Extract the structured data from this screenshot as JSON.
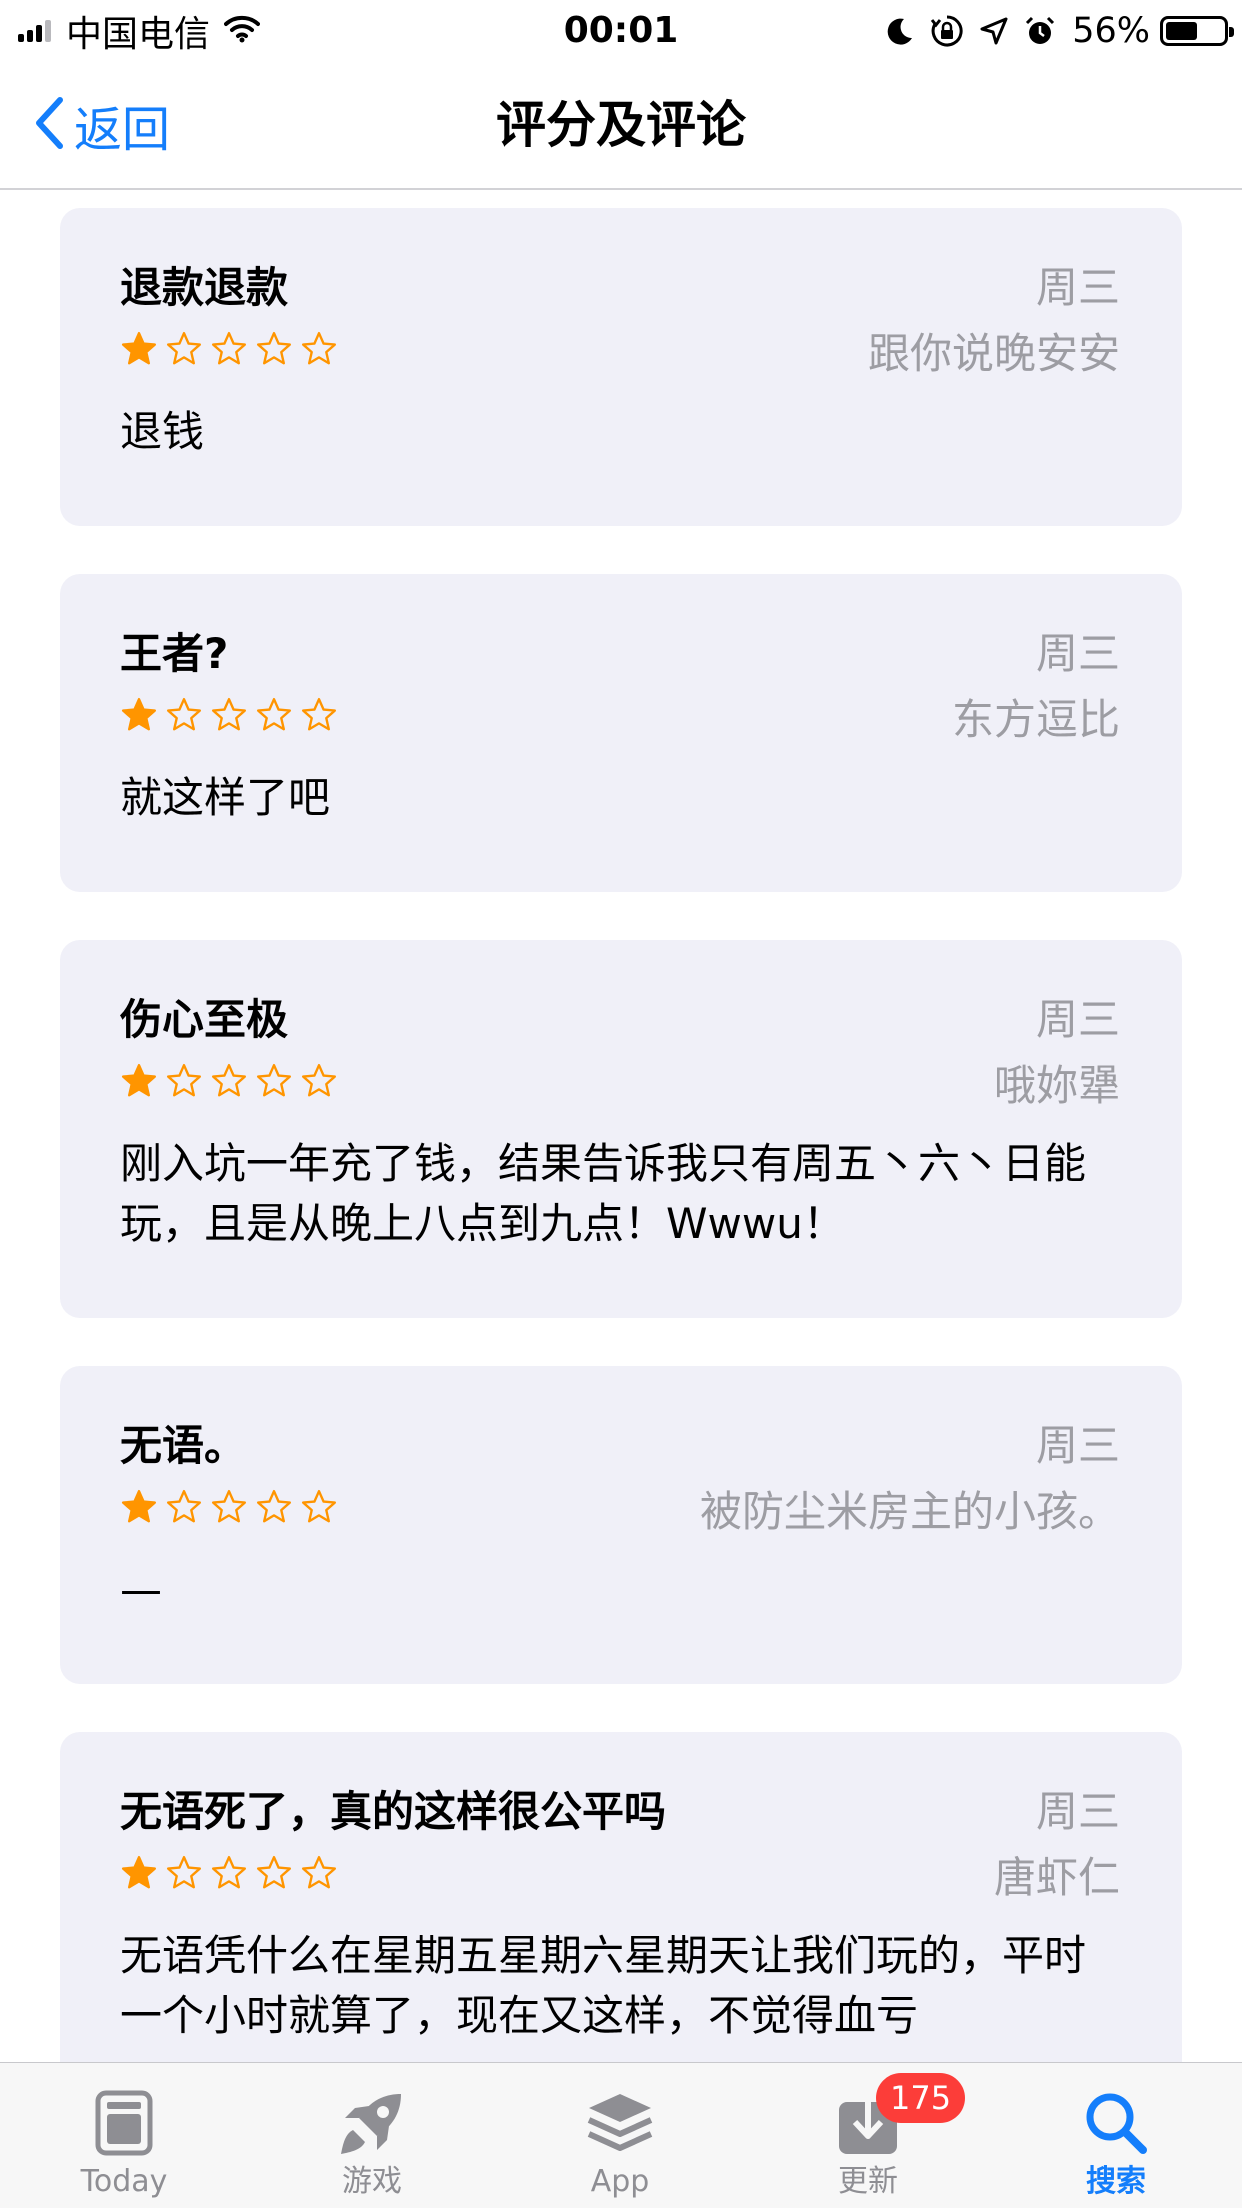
{
  "status_bar": {
    "carrier": "中国电信",
    "time": "00:01",
    "battery": "56%",
    "battery_level": 0.56
  },
  "nav": {
    "back_label": "返回",
    "title": "评分及评论"
  },
  "reviews": [
    {
      "title": "退款退款",
      "date": "周三",
      "author": "跟你说晚安安",
      "rating": 1,
      "body": "退钱"
    },
    {
      "title": "王者?",
      "date": "周三",
      "author": "东方逗比",
      "rating": 1,
      "body": "就这样了吧"
    },
    {
      "title": "伤心至极",
      "date": "周三",
      "author": "哦妳犟",
      "rating": 1,
      "body": "刚入坑一年充了钱，结果告诉我只有周五丶六丶日能玩，且是从晚上八点到九点！Wwwu！"
    },
    {
      "title": "无语。",
      "date": "周三",
      "author": "被防尘米房主的小孩。",
      "rating": 1,
      "body": "—"
    },
    {
      "title": "无语死了，真的这样很公平吗",
      "date": "周三",
      "author": "唐虾仁",
      "rating": 1,
      "body": "无语凭什么在星期五星期六星期天让我们玩的，平时一个小时就算了，现在又这样，不觉得血亏"
    }
  ],
  "tab_bar": {
    "tabs": [
      {
        "label": "Today",
        "icon": "today-icon"
      },
      {
        "label": "游戏",
        "icon": "rocket-icon"
      },
      {
        "label": "App",
        "icon": "app-stack-icon"
      },
      {
        "label": "更新",
        "icon": "download-icon",
        "badge": "175"
      },
      {
        "label": "搜索",
        "icon": "search-icon",
        "active": true
      }
    ]
  },
  "colors": {
    "accent": "#147efb",
    "star": "#ff9500",
    "card_bg": "#f0f0f8",
    "badge": "#fc3d39"
  }
}
